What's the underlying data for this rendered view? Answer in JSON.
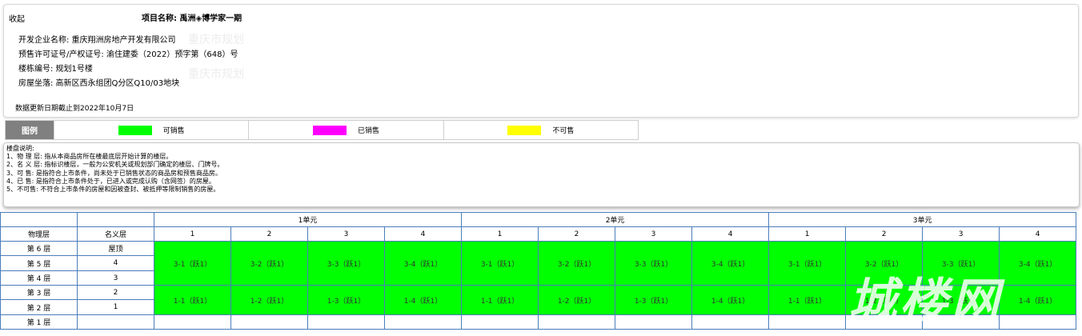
{
  "header": {
    "collapse_label": "收起",
    "project_title": "项目名称: 禹洲◈博学家一期"
  },
  "info": {
    "developer": "开发企业名称: 重庆翔洲房地产开发有限公司",
    "permit": "预售许可证号/产权证号: 渝住建委（2022）预字第（648）号",
    "building": "楼栋编号: 规划1号楼",
    "location": "房屋坐落: 高新区西永组团Q分区Q10/03地块",
    "update": "数据更新日期截止到2022年10月7日"
  },
  "watermarks": [
    "重庆市规划",
    "重庆市规划"
  ],
  "legend": {
    "title": "图例",
    "items": [
      {
        "label": "可销售",
        "color": "#00ff00"
      },
      {
        "label": "已销售",
        "color": "#ff00ff"
      },
      {
        "label": "不可售",
        "color": "#ffff00"
      }
    ]
  },
  "notes": {
    "title": "楼盘说明:",
    "lines": [
      "1、物 理 层: 指从本商品房所在楼最底层开始计算的楼层。",
      "2、名 义 层: 指标识楼层，一般为公安机关或规划部门确定的楼层、门牌号。",
      "3、可 售: 是指符合上市条件，尚未处于已销售状态的商品房和预售商品房。",
      "4、已 售: 是指符合上市条件处于，已进入或完成认购（含网签）的房屋。",
      "5、不可售: 不符合上市条件的房屋和因被查封、被抵押等限制销售的房屋。"
    ]
  },
  "table": {
    "col_physical": "物理层",
    "col_nominal": "名义层",
    "units": [
      "1单元",
      "2单元",
      "3单元"
    ],
    "rooms": [
      "1",
      "2",
      "3",
      "4"
    ],
    "floors": [
      {
        "physical": "第 6 层",
        "nominal": "屋顶"
      },
      {
        "physical": "第 5 层",
        "nominal": "4"
      },
      {
        "physical": "第 4 层",
        "nominal": "3"
      },
      {
        "physical": "第 3 层",
        "nominal": "2"
      },
      {
        "physical": "第 2 层",
        "nominal": "1"
      },
      {
        "physical": "第 1 层",
        "nominal": ""
      }
    ],
    "upper_rooms": [
      "3-1（跃1）",
      "3-2（跃1）",
      "3-3（跃1）",
      "3-4（跃1）",
      "3-1（跃1）",
      "3-2（跃1）",
      "3-3（跃1）",
      "3-4（跃1）",
      "3-1（跃1）",
      "3-2（跃1）",
      "3-3（跃1）",
      "3-4（跃1）"
    ],
    "lower_rooms": [
      "1-1（跃1）",
      "1-2（跃1）",
      "1-3（跃1）",
      "1-4（跃1）",
      "1-1（跃1）",
      "1-2（跃1）",
      "1-3（跃1）",
      "1-4（跃1）",
      "1-1（跃1）",
      "1-2（跃1）",
      "1-3（跃1）",
      "1-4（跃1）"
    ]
  },
  "brand_watermark": "城楼网"
}
